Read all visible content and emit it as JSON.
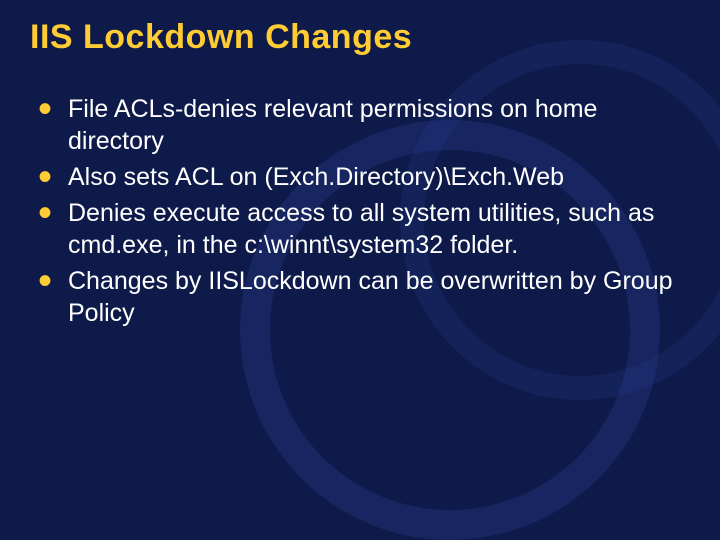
{
  "title": "IIS Lockdown Changes",
  "bullets": {
    "b0": "File ACLs-denies relevant permissions on home directory",
    "b1": "Also sets ACL on (Exch.Directory)\\Exch.Web",
    "b2": "Denies execute access to all system utilities, such as cmd.exe, in the c:\\winnt\\system32 folder.",
    "b3": "Changes by IISLockdown can be overwritten by Group Policy"
  }
}
